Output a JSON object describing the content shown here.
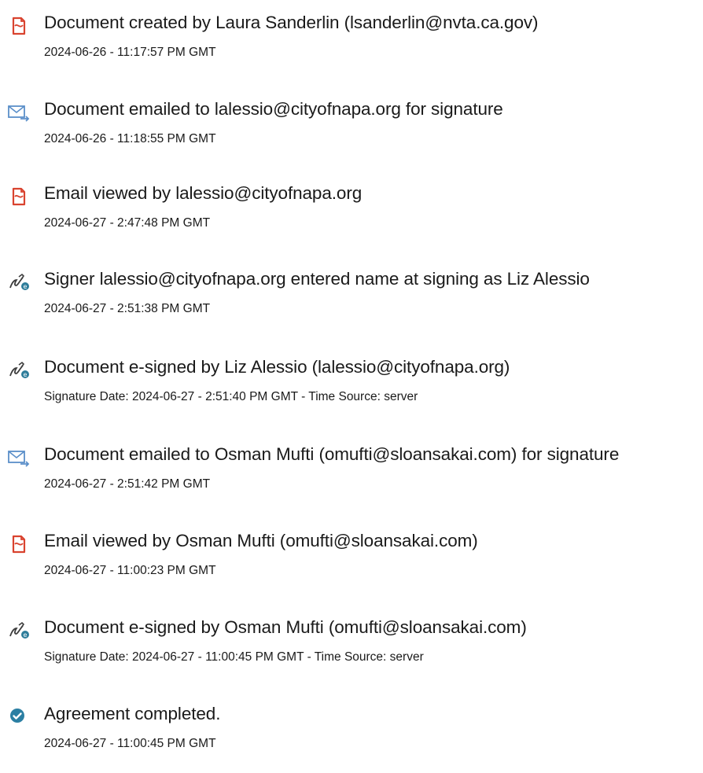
{
  "audit_events": [
    {
      "icon": "document-created-icon",
      "title": "Document created by Laura Sanderlin (lsanderlin@nvta.ca.gov)",
      "meta": "2024-06-26 - 11:17:57 PM GMT"
    },
    {
      "icon": "email-sent-icon",
      "title": "Document emailed to lalessio@cityofnapa.org for signature",
      "meta": "2024-06-26 - 11:18:55 PM GMT"
    },
    {
      "icon": "document-viewed-icon",
      "title": "Email viewed by lalessio@cityofnapa.org",
      "meta": "2024-06-27 - 2:47:48 PM GMT"
    },
    {
      "icon": "esign-icon",
      "title": "Signer lalessio@cityofnapa.org entered name at signing as Liz Alessio",
      "meta": "2024-06-27 - 2:51:38 PM GMT"
    },
    {
      "icon": "esign-icon",
      "title": "Document e-signed by Liz Alessio (lalessio@cityofnapa.org)",
      "meta": "Signature Date: 2024-06-27 - 2:51:40 PM GMT - Time Source: server"
    },
    {
      "icon": "email-sent-icon",
      "title": "Document emailed to Osman Mufti (omufti@sloansakai.com) for signature",
      "meta": "2024-06-27 - 2:51:42 PM GMT"
    },
    {
      "icon": "document-viewed-icon",
      "title": "Email viewed by Osman Mufti (omufti@sloansakai.com)",
      "meta": "2024-06-27 - 11:00:23 PM GMT"
    },
    {
      "icon": "esign-icon",
      "title": "Document e-signed by Osman Mufti (omufti@sloansakai.com)",
      "meta": "Signature Date: 2024-06-27 - 11:00:45 PM GMT - Time Source: server"
    },
    {
      "icon": "check-circle-icon",
      "title": "Agreement completed.",
      "meta": "2024-06-27 - 11:00:45 PM GMT"
    }
  ],
  "colors": {
    "text": "#1a1a1a",
    "document_icon": "#d9432f",
    "email_icon": "#5b8fc9",
    "sign_icon": "#3d3d3d",
    "sign_badge": "#2e7d9a",
    "check_icon": "#2b7fa3"
  }
}
